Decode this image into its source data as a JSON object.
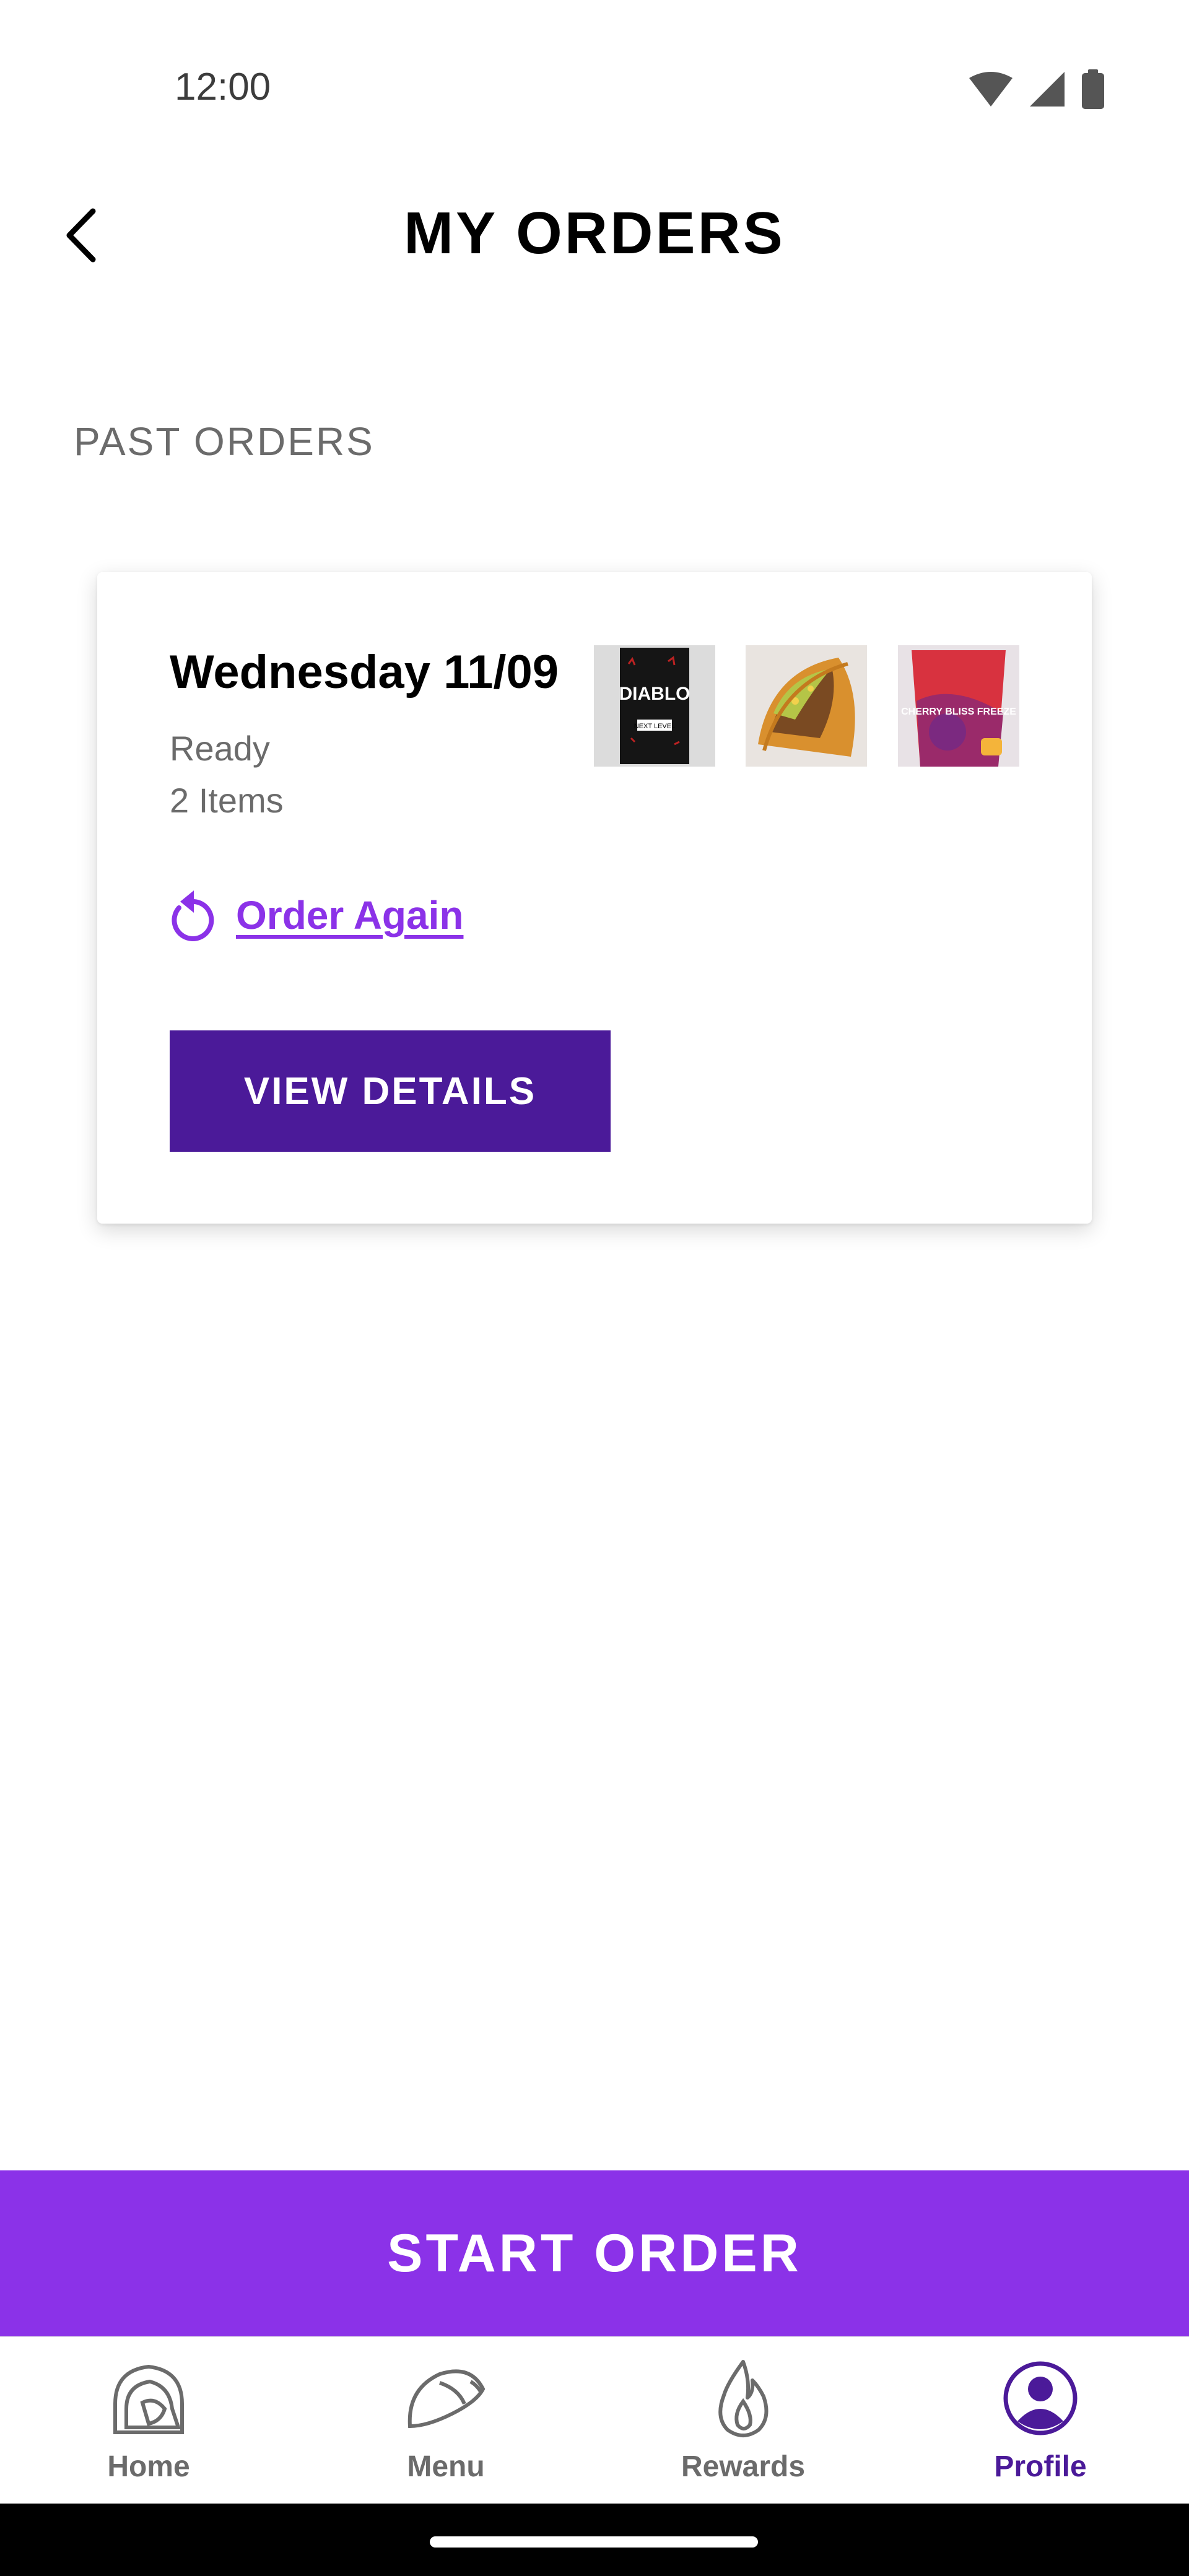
{
  "status_bar": {
    "time": "12:00"
  },
  "header": {
    "title": "MY ORDERS"
  },
  "section": {
    "label": "PAST ORDERS"
  },
  "order": {
    "date": "Wednesday 11/09",
    "status": "Ready",
    "items_count": "2 Items",
    "thumbnails": [
      {
        "name": "diablo-sauce-packet",
        "text": "DIABLO",
        "subtext": "NEXT LEVEL"
      },
      {
        "name": "crunchy-taco",
        "text": ""
      },
      {
        "name": "cherry-bliss-freeze",
        "text": "CHERRY BLISS FREEZE"
      }
    ],
    "order_again_label": "Order Again",
    "view_details_label": "VIEW DETAILS"
  },
  "start_order_label": "START ORDER",
  "bottom_nav": {
    "items": [
      {
        "label": "Home",
        "icon": "bell-icon",
        "active": false
      },
      {
        "label": "Menu",
        "icon": "taco-icon",
        "active": false
      },
      {
        "label": "Rewards",
        "icon": "flame-icon",
        "active": false
      },
      {
        "label": "Profile",
        "icon": "profile-icon",
        "active": true
      }
    ]
  },
  "colors": {
    "accent": "#8b32e8",
    "primary_dark": "#4b1a99",
    "muted_text": "#6b6b6b"
  }
}
